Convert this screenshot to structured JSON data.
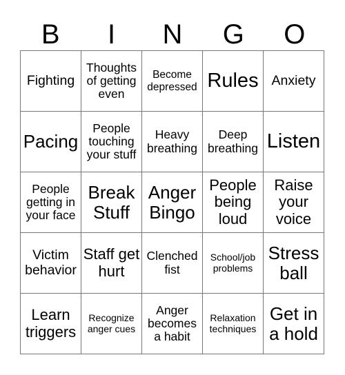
{
  "header": {
    "letters": [
      "B",
      "I",
      "N",
      "G",
      "O"
    ]
  },
  "cells": [
    [
      "Fighting",
      "Thoughts of getting even",
      "Become depressed",
      "Rules",
      "Anxiety"
    ],
    [
      "Pacing",
      "People touching your stuff",
      "Heavy breathing",
      "Deep breathing",
      "Listen"
    ],
    [
      "People getting in your face",
      "Break Stuff",
      "Anger Bingo",
      "People being loud",
      "Raise your voice"
    ],
    [
      "Victim behavior",
      "Staff get hurt",
      "Clenched fist",
      "School/job problems",
      "Stress ball"
    ],
    [
      "Learn triggers",
      "Recognize anger cues",
      "Anger becomes a habit",
      "Relaxation techniques",
      "Get in a hold"
    ]
  ]
}
